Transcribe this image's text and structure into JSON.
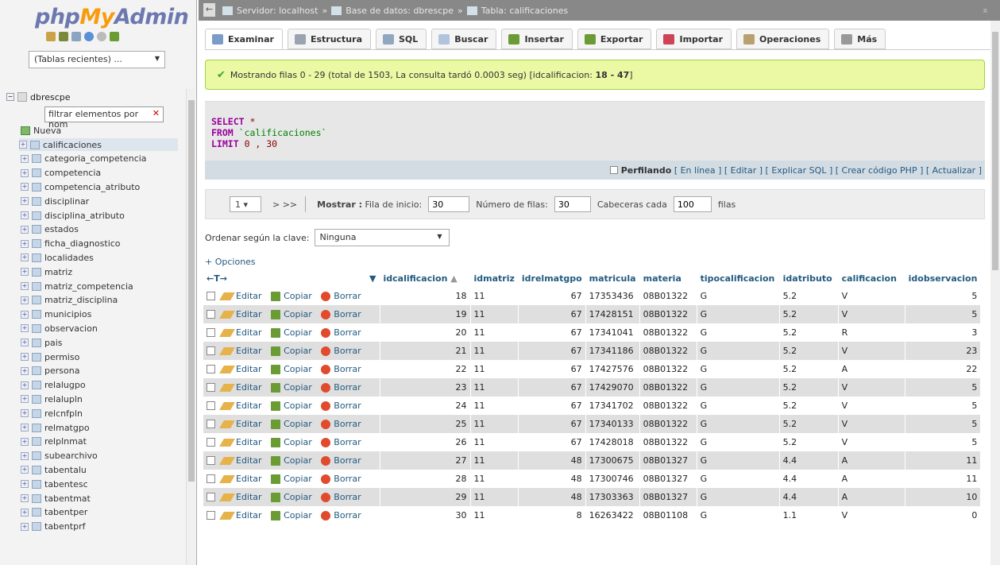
{
  "app": {
    "logo_php": "php",
    "logo_my": "My",
    "logo_admin": "Admin",
    "recent_tables": "(Tablas recientes) ..."
  },
  "sidebar": {
    "db_name": "dbrescpe",
    "filter_placeholder": "filtrar elementos por nom",
    "new_label": "Nueva",
    "tables": [
      "calificaciones",
      "categoria_competencia",
      "competencia",
      "competencia_atributo",
      "disciplinar",
      "disciplina_atributo",
      "estados",
      "ficha_diagnostico",
      "localidades",
      "matriz",
      "matriz_competencia",
      "matriz_disciplina",
      "municipios",
      "observacion",
      "pais",
      "permiso",
      "persona",
      "relalugpo",
      "relalupln",
      "relcnfpln",
      "relmatgpo",
      "relplnmat",
      "subearchivo",
      "tabentalu",
      "tabentesc",
      "tabentmat",
      "tabentper",
      "tabentprf"
    ]
  },
  "breadcrumb": {
    "server": "Servidor: localhost",
    "database": "Base de datos: dbrescpe",
    "table": "Tabla: calificaciones",
    "sep": "»"
  },
  "tabs": [
    {
      "label": "Examinar",
      "color": "#7a9cc6"
    },
    {
      "label": "Estructura",
      "color": "#9aa3b0"
    },
    {
      "label": "SQL",
      "color": "#8fa8c0"
    },
    {
      "label": "Buscar",
      "color": "#b0c4de"
    },
    {
      "label": "Insertar",
      "color": "#6a9b35"
    },
    {
      "label": "Exportar",
      "color": "#6a9b35"
    },
    {
      "label": "Importar",
      "color": "#c45"
    },
    {
      "label": "Operaciones",
      "color": "#b8a070"
    },
    {
      "label": "Más",
      "color": "#999"
    }
  ],
  "notice": {
    "text": "Mostrando filas 0 - 29 (total de 1503, La consulta tardó 0.0003 seg) [idcalificacion: ",
    "range": "18 - 47",
    "tail": "]"
  },
  "sql": {
    "select": "SELECT",
    "star": "*",
    "from": "FROM",
    "table": "`calificaciones`",
    "limit": "LIMIT",
    "limit_val": "0 , 30"
  },
  "profiling": {
    "label": "Perfilando",
    "links": "[ En línea ] [ Editar ] [ Explicar SQL ] [ Crear código PHP ] [ Actualizar ]"
  },
  "nav": {
    "page": "1",
    "next": ">  >>",
    "show": "Mostrar :",
    "start_label": "Fila de inicio:",
    "start_val": "30",
    "rows_label": "Número de filas:",
    "rows_val": "30",
    "headers_label": "Cabeceras cada",
    "headers_val": "100",
    "rows_suffix": "filas"
  },
  "order": {
    "label": "Ordenar según la clave:",
    "value": "Ninguna"
  },
  "options": "+ Opciones",
  "table": {
    "arrows": "←T→",
    "columns": [
      "idcalificacion",
      "idmatriz",
      "idrelmatgpo",
      "matricula",
      "materia",
      "tipocalificacion",
      "idatributo",
      "calificacion",
      "idobservacion"
    ],
    "actions": {
      "edit": "Editar",
      "copy": "Copiar",
      "delete": "Borrar"
    },
    "rows": [
      [
        "18",
        "11",
        "67",
        "17353436",
        "08B01322",
        "G",
        "5.2",
        "V",
        "5"
      ],
      [
        "19",
        "11",
        "67",
        "17428151",
        "08B01322",
        "G",
        "5.2",
        "V",
        "5"
      ],
      [
        "20",
        "11",
        "67",
        "17341041",
        "08B01322",
        "G",
        "5.2",
        "R",
        "3"
      ],
      [
        "21",
        "11",
        "67",
        "17341186",
        "08B01322",
        "G",
        "5.2",
        "V",
        "23"
      ],
      [
        "22",
        "11",
        "67",
        "17427576",
        "08B01322",
        "G",
        "5.2",
        "A",
        "22"
      ],
      [
        "23",
        "11",
        "67",
        "17429070",
        "08B01322",
        "G",
        "5.2",
        "V",
        "5"
      ],
      [
        "24",
        "11",
        "67",
        "17341702",
        "08B01322",
        "G",
        "5.2",
        "V",
        "5"
      ],
      [
        "25",
        "11",
        "67",
        "17340133",
        "08B01322",
        "G",
        "5.2",
        "V",
        "5"
      ],
      [
        "26",
        "11",
        "67",
        "17428018",
        "08B01322",
        "G",
        "5.2",
        "V",
        "5"
      ],
      [
        "27",
        "11",
        "48",
        "17300675",
        "08B01327",
        "G",
        "4.4",
        "A",
        "11"
      ],
      [
        "28",
        "11",
        "48",
        "17300746",
        "08B01327",
        "G",
        "4.4",
        "A",
        "11"
      ],
      [
        "29",
        "11",
        "48",
        "17303363",
        "08B01327",
        "G",
        "4.4",
        "A",
        "10"
      ],
      [
        "30",
        "11",
        "8",
        "16263422",
        "08B01108",
        "G",
        "1.1",
        "V",
        "0"
      ]
    ]
  }
}
